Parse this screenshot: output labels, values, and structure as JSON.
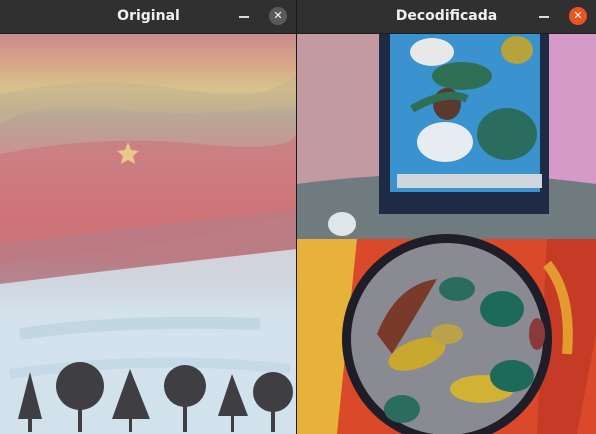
{
  "windows": {
    "original": {
      "title": "Original",
      "minimize_glyph": "–",
      "close_glyph": "✕",
      "image_description_icon": "watercolor-painting"
    },
    "decoded": {
      "title": "Decodificada",
      "minimize_glyph": "–",
      "close_glyph": "✕",
      "image_description_icon": "acrylic-painting"
    }
  },
  "colors": {
    "titlebar": "#303030",
    "close_inactive": "#5a5a5a",
    "close_active": "#e95420"
  }
}
